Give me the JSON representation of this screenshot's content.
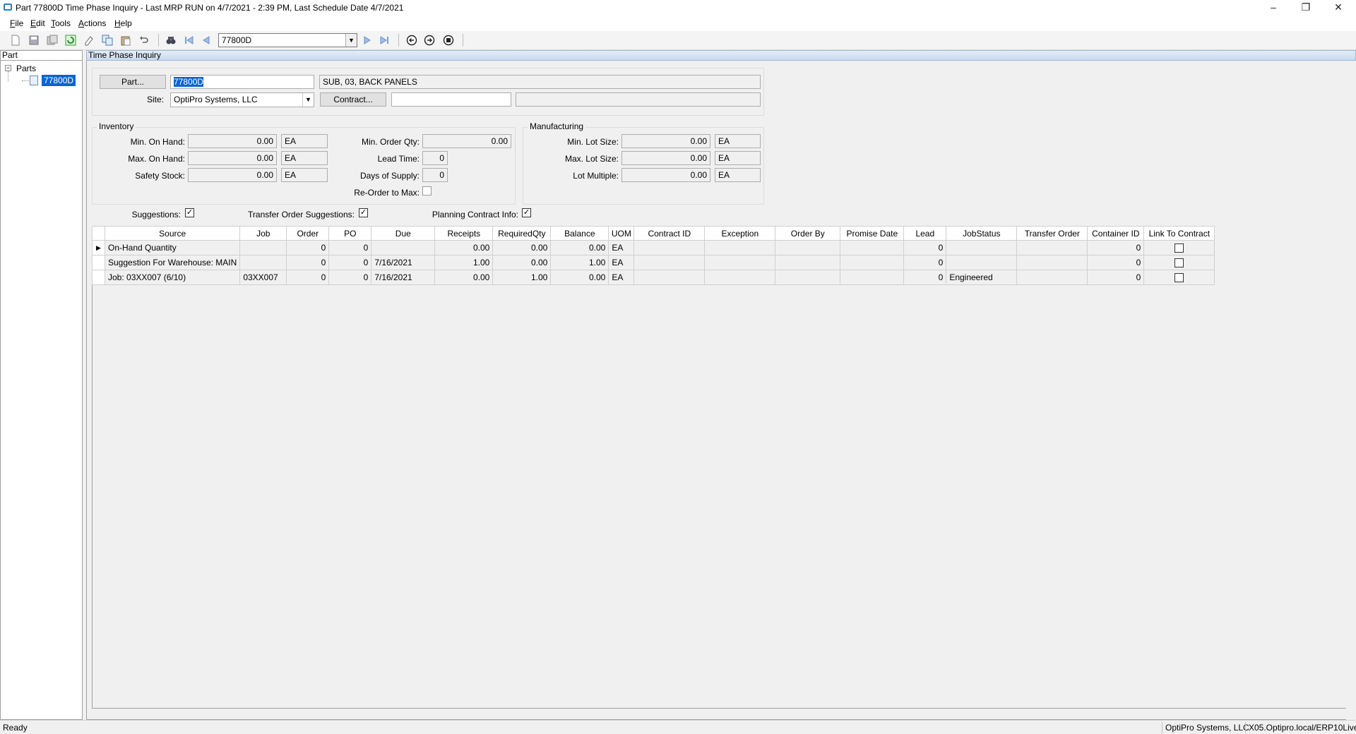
{
  "window": {
    "title": "Part 77800D Time Phase Inquiry  - Last MRP RUN on 4/7/2021 - 2:39 PM, Last Schedule Date  4/7/2021",
    "minimize": "–",
    "restore": "❐",
    "close": "✕"
  },
  "menu": {
    "file": {
      "u": "F",
      "rest": "ile"
    },
    "edit": {
      "u": "E",
      "rest": "dit"
    },
    "tools": {
      "u": "T",
      "rest": "ools"
    },
    "actions": {
      "u": "A",
      "rest": "ctions"
    },
    "help": {
      "u": "H",
      "rest": "elp"
    }
  },
  "toolbar": {
    "nav_value": "77800D"
  },
  "left_panel": {
    "header": "Part",
    "tree_toggle": "−",
    "root": "Parts",
    "item": "77800D"
  },
  "main": {
    "header": "Time Phase Inquiry",
    "part_button": "Part...",
    "part_value": "77800D",
    "part_description": "SUB, 03, BACK PANELS",
    "site_label": "Site:",
    "site_value": "OptiPro Systems, LLC",
    "contract_button": "Contract...",
    "contract_value": "",
    "contract_description": ""
  },
  "inventory": {
    "title": "Inventory",
    "min_on_hand_label": "Min. On Hand:",
    "min_on_hand": "0.00",
    "min_on_hand_uom": "EA",
    "max_on_hand_label": "Max. On Hand:",
    "max_on_hand": "0.00",
    "max_on_hand_uom": "EA",
    "safety_stock_label": "Safety Stock:",
    "safety_stock": "0.00",
    "safety_stock_uom": "EA",
    "min_order_qty_label": "Min. Order Qty:",
    "min_order_qty": "0.00",
    "lead_time_label": "Lead Time:",
    "lead_time": "0",
    "days_of_supply_label": "Days of Supply:",
    "days_of_supply": "0",
    "reorder_to_max_label": "Re-Order to Max:"
  },
  "manufacturing": {
    "title": "Manufacturing",
    "min_lot_size_label": "Min. Lot Size:",
    "min_lot_size": "0.00",
    "min_lot_size_uom": "EA",
    "max_lot_size_label": "Max. Lot Size:",
    "max_lot_size": "0.00",
    "max_lot_size_uom": "EA",
    "lot_multiple_label": "Lot Multiple:",
    "lot_multiple": "0.00",
    "lot_multiple_uom": "EA"
  },
  "options": {
    "suggestions_label": "Suggestions:",
    "transfer_order_suggestions_label": "Transfer Order Suggestions:",
    "planning_contract_info_label": "Planning Contract Info:",
    "check_mark": "✓"
  },
  "grid": {
    "columns": [
      "Source",
      "Job",
      "Order",
      "PO",
      "Due",
      "Receipts",
      "RequiredQty",
      "Balance",
      "UOM",
      "Contract ID",
      "Exception",
      "Order By",
      "Promise Date",
      "Lead",
      "JobStatus",
      "Transfer Order",
      "Container ID",
      "Link To Contract"
    ],
    "current_row_marker": "▶",
    "rows": [
      {
        "source": "On-Hand Quantity",
        "job": "",
        "order": "0",
        "po": "0",
        "due": "",
        "receipts": "0.00",
        "required_qty": "0.00",
        "balance": "0.00",
        "uom": "EA",
        "contract_id": "",
        "exception": "",
        "order_by": "",
        "promise_date": "",
        "lead": "0",
        "job_status": "",
        "transfer_order": "",
        "container_id": "0"
      },
      {
        "source": "Suggestion For Warehouse: MAIN",
        "job": "",
        "order": "0",
        "po": "0",
        "due": "7/16/2021",
        "receipts": "1.00",
        "required_qty": "0.00",
        "balance": "1.00",
        "uom": "EA",
        "contract_id": "",
        "exception": "",
        "order_by": "",
        "promise_date": "",
        "lead": "0",
        "job_status": "",
        "transfer_order": "",
        "container_id": "0"
      },
      {
        "source": "Job: 03XX007 (6/10)",
        "job": "03XX007",
        "order": "0",
        "po": "0",
        "due": "7/16/2021",
        "receipts": "0.00",
        "required_qty": "1.00",
        "balance": "0.00",
        "uom": "EA",
        "contract_id": "",
        "exception": "",
        "order_by": "",
        "promise_date": "",
        "lead": "0",
        "job_status": "Engineered",
        "transfer_order": "",
        "container_id": "0"
      }
    ]
  },
  "status": {
    "left": "Ready",
    "company": "OptiPro Systems, LLC",
    "server": "X05.Optipro.local/ERP10Live"
  }
}
